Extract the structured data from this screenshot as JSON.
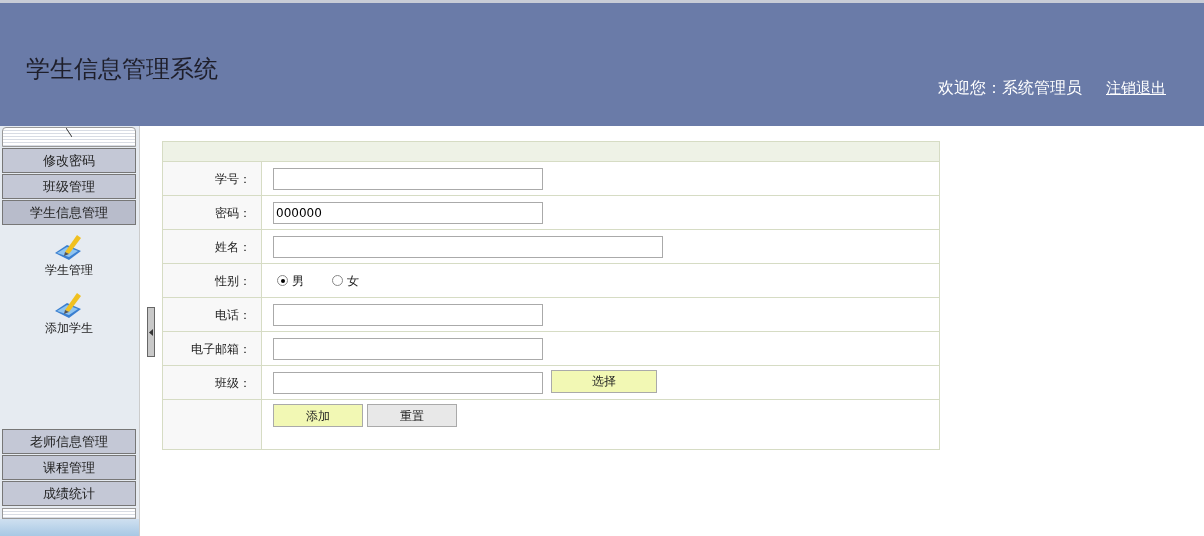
{
  "header": {
    "title": "学生信息管理系统",
    "welcome": "欢迎您：系统管理员",
    "logout": "注销退出"
  },
  "sidebar": {
    "menus": [
      {
        "label": "修改密码",
        "expanded": false
      },
      {
        "label": "班级管理",
        "expanded": false
      },
      {
        "label": "学生信息管理",
        "expanded": true,
        "children": [
          {
            "label": "学生管理"
          },
          {
            "label": "添加学生"
          }
        ]
      },
      {
        "label": "老师信息管理",
        "expanded": false
      },
      {
        "label": "课程管理",
        "expanded": false
      },
      {
        "label": "成绩统计",
        "expanded": false
      }
    ]
  },
  "form": {
    "rows": [
      {
        "kind": "text",
        "label": "学号：",
        "value": "",
        "wide": false
      },
      {
        "kind": "text",
        "label": "密码：",
        "value": "000000",
        "wide": false
      },
      {
        "kind": "text",
        "label": "姓名：",
        "value": "",
        "wide": true
      },
      {
        "kind": "radio",
        "label": "性别：",
        "options": [
          {
            "label": "男",
            "selected": true
          },
          {
            "label": "女",
            "selected": false
          }
        ]
      },
      {
        "kind": "text",
        "label": "电话：",
        "value": "",
        "wide": false
      },
      {
        "kind": "text",
        "label": "电子邮箱：",
        "value": "",
        "wide": false
      },
      {
        "kind": "pick",
        "label": "班级：",
        "value": "",
        "button": "选择"
      }
    ],
    "buttons": [
      {
        "label": "添加",
        "kind": "primary"
      },
      {
        "label": "重置",
        "kind": "secondary"
      }
    ]
  }
}
